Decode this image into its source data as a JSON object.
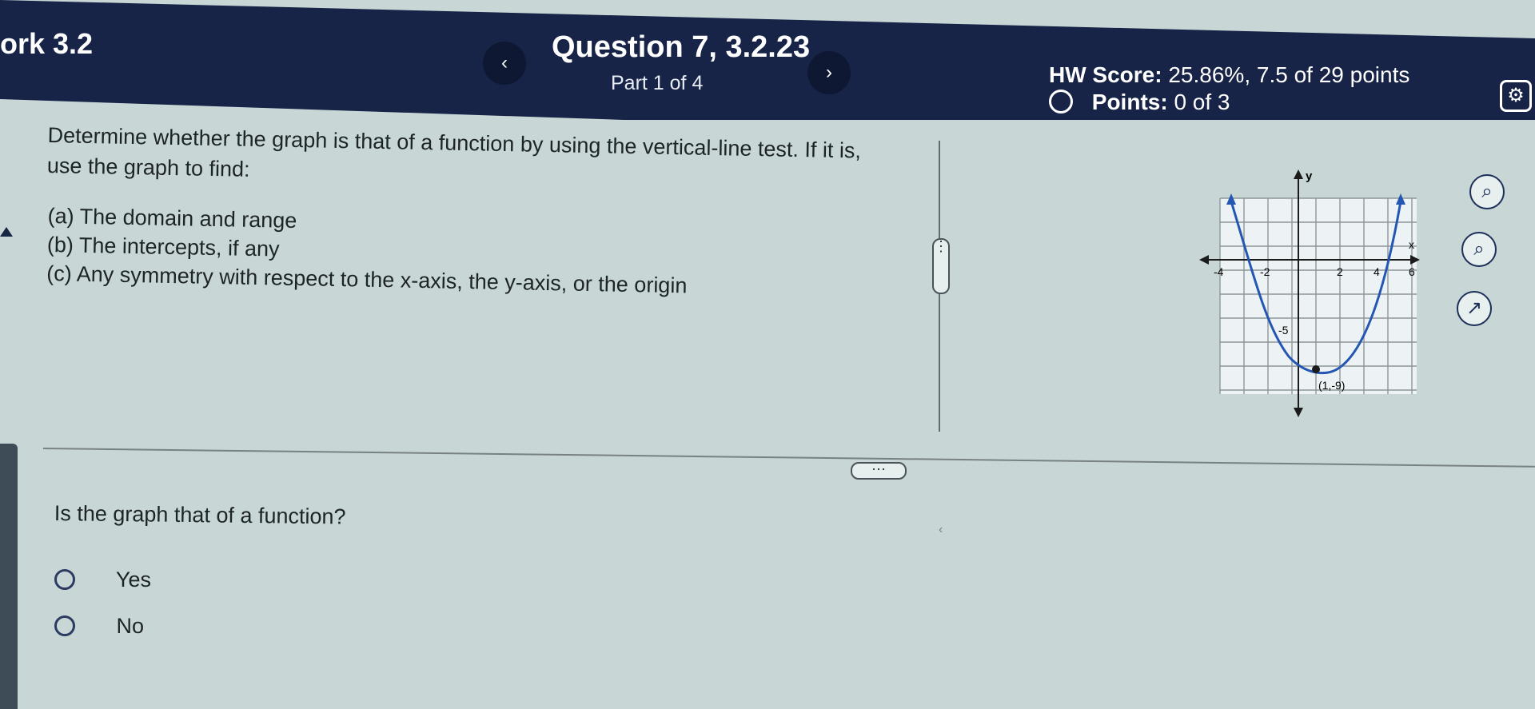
{
  "header": {
    "homework_title": "ork 3.2",
    "question_title": "Question 7, 3.2.23",
    "part_label": "Part 1 of 4",
    "hw_score_label": "HW Score:",
    "hw_score_value": "25.86%, 7.5 of 29 points",
    "points_label": "Points:",
    "points_value": "0 of 3",
    "prev_icon": "chevron-left-icon",
    "next_icon": "chevron-right-icon",
    "settings_icon": "gear-icon"
  },
  "question": {
    "prompt_line1": "Determine whether the graph is that of a function by using the vertical-line test. If it is,",
    "prompt_line2": "use the graph to find:",
    "parts": [
      "(a) The domain and range",
      "(b) The intercepts, if any",
      "(c) Any symmetry with respect to the x-axis, the y-axis, or the origin"
    ],
    "ask": "Is the graph that of a function?",
    "options": [
      "Yes",
      "No"
    ]
  },
  "graph": {
    "x_axis_label": "x",
    "y_axis_label": "y",
    "tick_labels": [
      "-4",
      "-2",
      "2",
      "4",
      "6"
    ],
    "y_tick_label": "-5",
    "point_label": "(1,-9)"
  },
  "tools": {
    "zoom_in_icon": "zoom-in-icon",
    "zoom_out_icon": "zoom-out-icon",
    "popout_icon": "external-link-icon"
  }
}
